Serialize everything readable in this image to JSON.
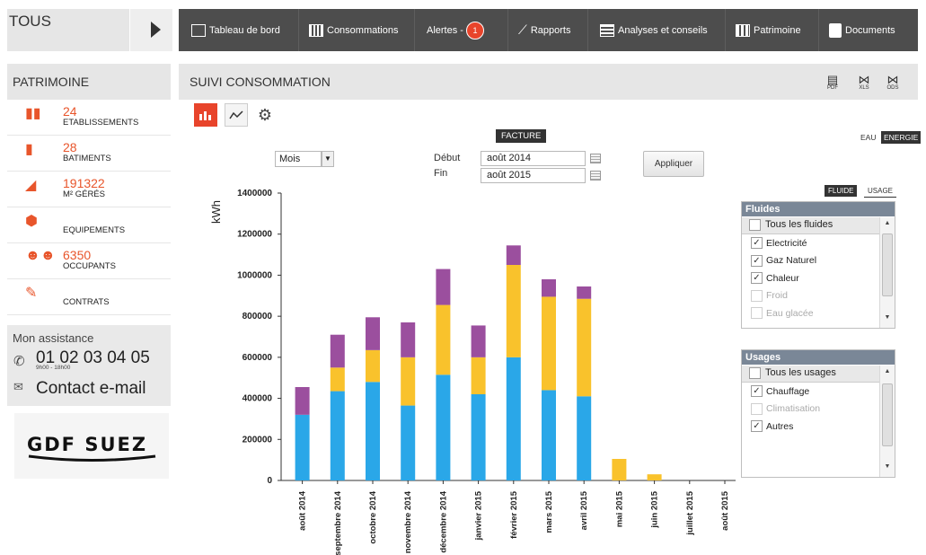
{
  "left": {
    "tous": "TOUS",
    "patrimoine_title": "PATRIMOINE",
    "stats": [
      {
        "num": "24",
        "label": "ETABLISSEMENTS",
        "icon": "buildings-icon"
      },
      {
        "num": "28",
        "label": "BATIMENTS",
        "icon": "building-icon"
      },
      {
        "num": "191322",
        "label": "M² GÉRÉS",
        "icon": "surface-icon"
      },
      {
        "num": "",
        "label": "EQUIPEMENTS",
        "icon": "box-icon"
      },
      {
        "num": "6350",
        "label": "OCCUPANTS",
        "icon": "people-icon"
      },
      {
        "num": "",
        "label": "CONTRATS",
        "icon": "contract-icon"
      }
    ],
    "assistance_title": "Mon assistance",
    "phone": "01 02 03 04 05",
    "hours": "9h00 - 18h00",
    "mail": "Contact e-mail",
    "logo": "GDF SUEZ"
  },
  "nav": {
    "items": [
      "Tableau de bord",
      "Consommations",
      "Alertes -",
      "Rapports",
      "Analyses et conseils",
      "Patrimoine",
      "Documents"
    ],
    "alert_count": "1"
  },
  "main": {
    "title": "SUIVI CONSOMMATION",
    "exports": [
      "PDF",
      "XLS",
      "ODS"
    ],
    "facture": "FACTURE",
    "eau": "EAU",
    "energie": "ENERGIE",
    "period": "Mois",
    "debut_label": "Début",
    "fin_label": "Fin",
    "debut": "août 2014",
    "fin": "août 2015",
    "apply": "Appliquer",
    "fluide": "FLUIDE",
    "usage": "USAGE"
  },
  "fluides": {
    "title": "Fluides",
    "all": "Tous les fluides",
    "items": [
      {
        "label": "Electricité",
        "checked": true
      },
      {
        "label": "Gaz Naturel",
        "checked": true
      },
      {
        "label": "Chaleur",
        "checked": true
      },
      {
        "label": "Froid",
        "checked": false
      },
      {
        "label": "Eau glacée",
        "checked": false
      }
    ]
  },
  "usages": {
    "title": "Usages",
    "all": "Tous les usages",
    "items": [
      {
        "label": "Chauffage",
        "checked": true
      },
      {
        "label": "Climatisation",
        "checked": false
      },
      {
        "label": "Autres",
        "checked": true
      }
    ]
  },
  "colors": {
    "accent": "#e8442b",
    "elec": "#2aa7e8",
    "gaz": "#f9c22c",
    "chaleur": "#9b4f9e"
  },
  "chart_data": {
    "type": "bar",
    "stacked": true,
    "ylabel": "kWh",
    "ylim": [
      0,
      1400000
    ],
    "yticks": [
      "0",
      "200000",
      "400000",
      "600000",
      "800000",
      "1000000",
      "1200000",
      "1400000"
    ],
    "categories": [
      "août 2014",
      "septembre 2014",
      "octobre 2014",
      "novembre 2014",
      "décembre 2014",
      "janvier 2015",
      "février 2015",
      "mars 2015",
      "avril 2015",
      "mai 2015",
      "juin 2015",
      "juillet 2015",
      "août 2015"
    ],
    "series": [
      {
        "values": [
          320000,
          435000,
          480000,
          365000,
          515000,
          420000,
          600000,
          440000,
          410000,
          0,
          0,
          0,
          0
        ]
      },
      {
        "values": [
          0,
          115000,
          155000,
          235000,
          340000,
          180000,
          450000,
          455000,
          475000,
          105000,
          30000,
          0,
          0
        ]
      },
      {
        "values": [
          135000,
          160000,
          160000,
          170000,
          175000,
          155000,
          95000,
          85000,
          60000,
          0,
          0,
          0,
          0
        ]
      }
    ]
  }
}
